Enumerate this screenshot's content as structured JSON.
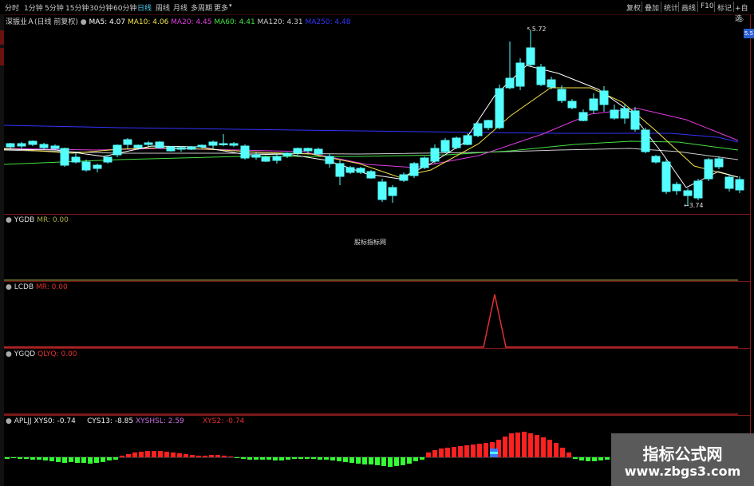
{
  "toolbar": {
    "periods": [
      {
        "label": "分时"
      },
      {
        "label": "1分钟"
      },
      {
        "label": "5分钟"
      },
      {
        "label": "15分钟"
      },
      {
        "label": "30分钟"
      },
      {
        "label": "60分钟"
      },
      {
        "label": "日线",
        "active": true
      },
      {
        "label": "周线"
      },
      {
        "label": "月线"
      },
      {
        "label": "多周期"
      },
      {
        "label": "更多"
      }
    ],
    "right_buttons": [
      {
        "label": "复权"
      },
      {
        "label": "叠加"
      },
      {
        "label": "统计"
      },
      {
        "label": "画线"
      },
      {
        "label": "F10"
      },
      {
        "label": "标记"
      },
      {
        "label": "+自选"
      }
    ]
  },
  "main": {
    "stock_name": "深振业Ａ",
    "period_label": "(日线 前复权)",
    "ma": [
      {
        "label": "MA5: 4.07",
        "color": "#ffffff"
      },
      {
        "label": "MA10: 4.06",
        "color": "#f2e24a"
      },
      {
        "label": "MA20: 4.45",
        "color": "#e03ce0"
      },
      {
        "label": "MA60: 4.41",
        "color": "#45e245"
      },
      {
        "label": "MA120: 4.31",
        "color": "#cccccc"
      },
      {
        "label": "MA250: 4.48",
        "color": "#3333ff"
      }
    ],
    "max_label": "5.72",
    "min_label": "3.74",
    "price_tag": "5.5",
    "center_note": "股标指标网"
  },
  "panels": {
    "ygdb": {
      "name": "YGDB",
      "items": [
        {
          "label": "MR: 0.00",
          "color": "#aaaa44"
        }
      ]
    },
    "lcdb": {
      "name": "LCDB",
      "items": [
        {
          "label": "MR: 0.00",
          "color": "#e33030"
        }
      ]
    },
    "ygqd": {
      "name": "YGQD",
      "items": [
        {
          "label": "QLYQ: 0.00",
          "color": "#e33030"
        }
      ]
    },
    "apljj": {
      "name": "APLJJ",
      "items": [
        {
          "label": "XYS0: -0.74",
          "color": "#eeeeee"
        },
        {
          "label": "CYS13: -8.85",
          "color": "#eeeeee"
        },
        {
          "label": "XYSHSL: 2.59",
          "color": "#c86ce0"
        },
        {
          "label": "XYS2: -0.74",
          "color": "#e33030"
        }
      ]
    }
  },
  "watermark": {
    "line1": "指标公式网",
    "line2": "www.zbgs3.com"
  }
}
